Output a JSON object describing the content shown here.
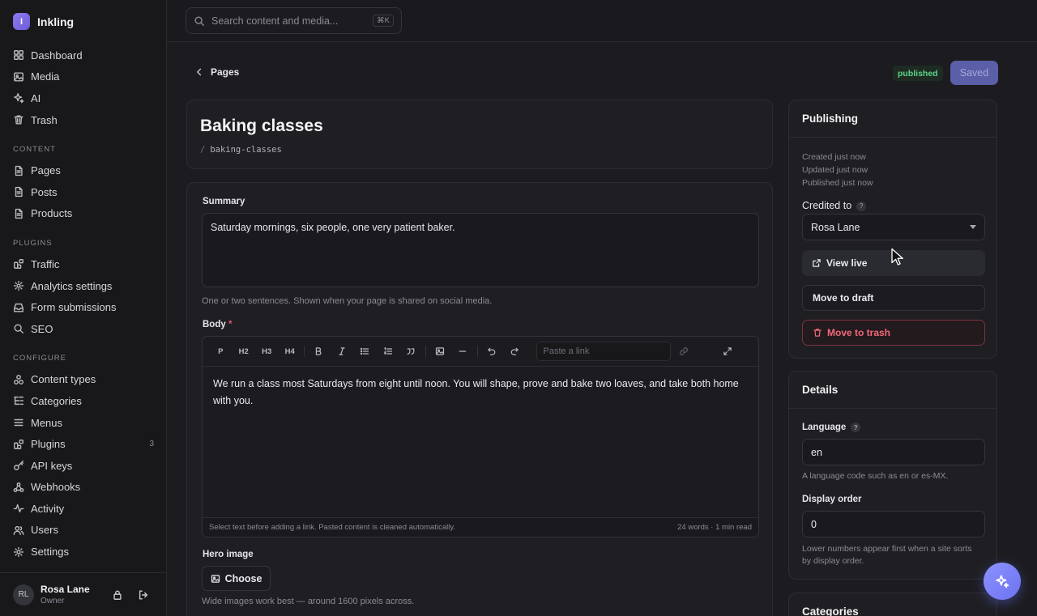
{
  "app": {
    "name": "Inkling",
    "logo_letter": "I",
    "accent": "#7c6ff0"
  },
  "search": {
    "placeholder": "Search content and media...",
    "shortcut": "⌘K"
  },
  "sidebar": {
    "main": [
      {
        "label": "Dashboard",
        "icon": "dashboard-icon"
      },
      {
        "label": "Media",
        "icon": "image-icon"
      },
      {
        "label": "AI",
        "icon": "sparkle-icon"
      },
      {
        "label": "Trash",
        "icon": "trash-icon"
      }
    ],
    "content_title": "CONTENT",
    "content": [
      {
        "label": "Pages",
        "icon": "document-icon"
      },
      {
        "label": "Posts",
        "icon": "document-icon"
      },
      {
        "label": "Products",
        "icon": "document-icon"
      }
    ],
    "plugins_title": "PLUGINS",
    "plugins": [
      {
        "label": "Traffic",
        "icon": "plugin-icon"
      },
      {
        "label": "Analytics settings",
        "icon": "gear-icon"
      },
      {
        "label": "Form submissions",
        "icon": "inbox-icon"
      },
      {
        "label": "SEO",
        "icon": "search-icon"
      }
    ],
    "configure_title": "CONFIGURE",
    "configure": [
      {
        "label": "Content types",
        "icon": "shapes-icon"
      },
      {
        "label": "Categories",
        "icon": "list-tree-icon"
      },
      {
        "label": "Menus",
        "icon": "menu-icon"
      },
      {
        "label": "Plugins",
        "icon": "plugin-icon",
        "count": "3"
      },
      {
        "label": "API keys",
        "icon": "key-icon"
      },
      {
        "label": "Webhooks",
        "icon": "webhook-icon"
      },
      {
        "label": "Activity",
        "icon": "activity-icon"
      },
      {
        "label": "Users",
        "icon": "users-icon"
      },
      {
        "label": "Settings",
        "icon": "gear-icon"
      }
    ]
  },
  "user": {
    "initials": "RL",
    "name": "Rosa Lane",
    "role": "Owner"
  },
  "header": {
    "back_label": "Pages",
    "status": "published",
    "save_label": "Saved"
  },
  "page": {
    "title": "Baking classes",
    "slug_sep": "/",
    "slug": "baking-classes"
  },
  "form": {
    "summary_label": "Summary",
    "summary_value": "Saturday mornings, six people, one very patient baker.",
    "summary_hint": "One or two sentences. Shown when your page is shared on social media.",
    "body_label": "Body",
    "body_required": "*",
    "toolbar": {
      "p": "P",
      "h2": "H2",
      "h3": "H3",
      "h4": "H4",
      "link_placeholder": "Paste a link"
    },
    "body_text": "We run a class most Saturdays from eight until noon. You will shape, prove and bake two loaves, and take both home with you.",
    "body_hint": "Select text before adding a link. Pasted content is cleaned automatically.",
    "body_stats": "24 words · 1 min read",
    "hero_label": "Hero image",
    "choose_label": "Choose",
    "hero_hint": "Wide images work best — around 1600 pixels across."
  },
  "publishing": {
    "title": "Publishing",
    "created": "Created just now",
    "updated": "Updated just now",
    "published": "Published just now",
    "credited_label": "Credited to",
    "help": "?",
    "credited_value": "Rosa Lane",
    "view_live": "View live",
    "move_draft": "Move to draft",
    "move_trash": "Move to trash"
  },
  "details": {
    "title": "Details",
    "language_label": "Language",
    "help": "?",
    "language_value": "en",
    "language_hint": "A language code such as en or es-MX.",
    "order_label": "Display order",
    "order_value": "0",
    "order_hint": "Lower numbers appear first when a site sorts by display order."
  },
  "categories": {
    "title": "Categories"
  }
}
